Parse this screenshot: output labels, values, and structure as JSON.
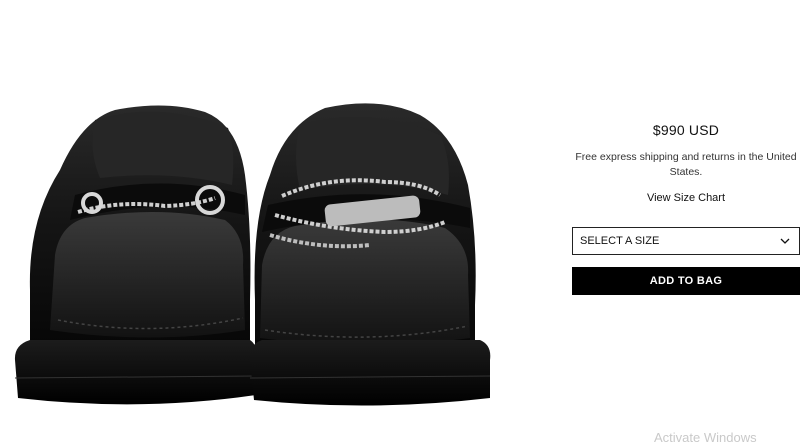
{
  "product": {
    "price": "$990 USD",
    "shipping_note": "Free express shipping and returns in the United States.",
    "size_chart_link": "View Size Chart",
    "size_select": {
      "selected": "SELECT A SIZE"
    },
    "add_to_bag_label": "ADD TO BAG",
    "image_subject": "black leather loafers with silver chain hardware"
  },
  "watermark": {
    "text": "Activate Windows"
  },
  "colors": {
    "button_bg": "#000000",
    "button_text": "#ffffff",
    "border": "#222222"
  }
}
